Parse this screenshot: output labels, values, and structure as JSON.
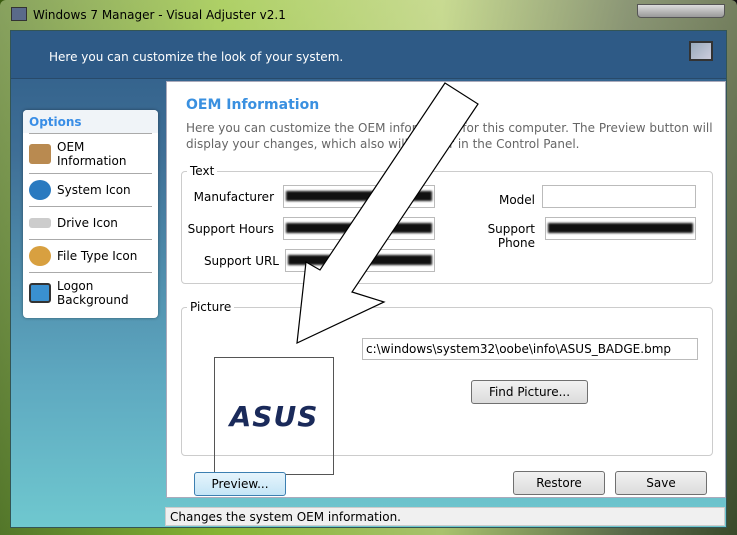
{
  "window": {
    "title": "Windows 7 Manager - Visual Adjuster v2.1"
  },
  "header": {
    "text": "Here you can customize the look of your system.",
    "icon": "monitor-paint-icon"
  },
  "sidebar": {
    "title": "Options",
    "items": [
      {
        "label": "OEM Information",
        "icon": "clipboard-icon"
      },
      {
        "label": "System Icon",
        "icon": "globe-computer-icon"
      },
      {
        "label": "Drive Icon",
        "icon": "drive-icon"
      },
      {
        "label": "File Type Icon",
        "icon": "palette-icon"
      },
      {
        "label": "Logon Background",
        "icon": "monitor-icon"
      }
    ]
  },
  "main": {
    "title": "OEM Information",
    "description": "Here you can customize the OEM information for this computer. The Preview button will display your changes, which also will appear in the Control Panel.",
    "text_group": "Text",
    "fields": {
      "manufacturer": "Manufacturer",
      "support_hours": "Support Hours",
      "support_url": "Support URL",
      "model": "Model",
      "support_phone": "Support Phone"
    },
    "picture_group": "Picture",
    "picture_logo": "ASUS",
    "picture_path": "c:\\windows\\system32\\oobe\\info\\ASUS_BADGE.bmp",
    "find_picture": "Find Picture...",
    "preview": "Preview...",
    "restore": "Restore",
    "save": "Save"
  },
  "status": "Changes the system OEM information."
}
